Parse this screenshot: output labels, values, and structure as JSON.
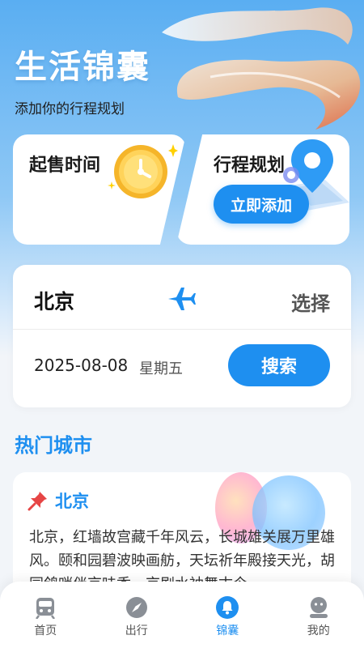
{
  "header": {
    "title": "生活锦囊",
    "subtitle": "添加你的行程规划"
  },
  "cards": {
    "sale_time": {
      "title": "起售时间",
      "icon": "clock-icon"
    },
    "trip_plan": {
      "title": "行程规划",
      "button": "立即添加",
      "icon": "location-pin-icon"
    }
  },
  "search": {
    "from_city": "北京",
    "select_label": "选择",
    "date": "2025-08-08",
    "weekday": "星期五",
    "search_button": "搜索"
  },
  "hot_cities": {
    "section_title": "热门城市",
    "items": [
      {
        "name": "北京",
        "description": "北京，红墙故宫藏千年风云，长城雄关展万里雄风。颐和园碧波映画舫，天坛祈年殿接天光，胡同鸽哨伴京味香，京剧水袖舞古今。"
      }
    ]
  },
  "tabs": [
    {
      "label": "首页",
      "icon": "train-icon",
      "active": false
    },
    {
      "label": "出行",
      "icon": "compass-icon",
      "active": false
    },
    {
      "label": "锦囊",
      "icon": "bell-icon",
      "active": true
    },
    {
      "label": "我的",
      "icon": "profile-icon",
      "active": false
    }
  ],
  "colors": {
    "accent": "#1e8ff0",
    "hero_top": "#5aaef2",
    "background": "#f2f5f9",
    "inactive_tab": "#8a8f96"
  }
}
